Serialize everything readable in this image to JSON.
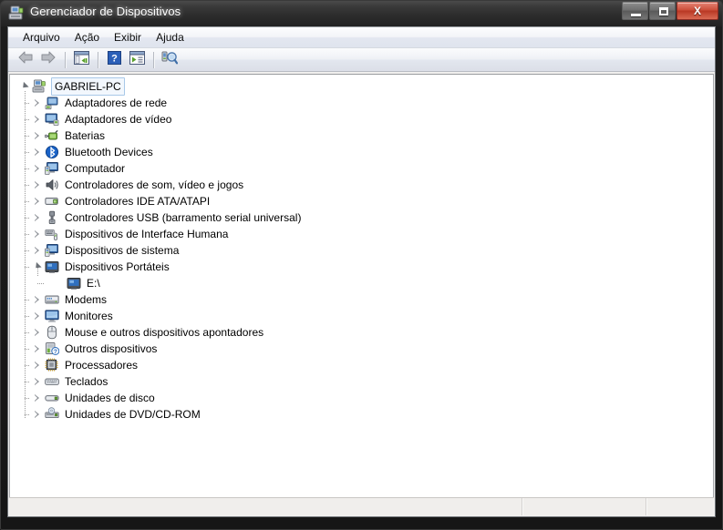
{
  "window": {
    "title": "Gerenciador de Dispositivos",
    "title_icon": "device-manager-icon",
    "buttons": {
      "minimize": "minimize-button",
      "maximize": "maximize-button",
      "close_label": "X"
    }
  },
  "menubar": {
    "items": [
      {
        "label": "Arquivo",
        "name": "menu-arquivo"
      },
      {
        "label": "Ação",
        "name": "menu-acao"
      },
      {
        "label": "Exibir",
        "name": "menu-exibir"
      },
      {
        "label": "Ajuda",
        "name": "menu-ajuda"
      }
    ]
  },
  "toolbar": {
    "items": [
      {
        "name": "back-arrow-icon",
        "type": "button"
      },
      {
        "name": "forward-arrow-icon",
        "type": "button"
      },
      {
        "name": "separator-1",
        "type": "separator"
      },
      {
        "name": "show-hide-console-tree-icon",
        "type": "button"
      },
      {
        "name": "separator-2",
        "type": "separator"
      },
      {
        "name": "help-icon",
        "type": "button"
      },
      {
        "name": "properties-icon",
        "type": "button"
      },
      {
        "name": "separator-3",
        "type": "separator"
      },
      {
        "name": "scan-for-hardware-changes-icon",
        "type": "button"
      }
    ]
  },
  "tree": {
    "root": {
      "label": "GABRIEL-PC",
      "icon": "computer-tower-icon",
      "expanded": true,
      "selected": true
    },
    "nodes": [
      {
        "label": "Adaptadores de rede",
        "icon": "network-adapter-icon",
        "expanded": false
      },
      {
        "label": "Adaptadores de vídeo",
        "icon": "display-adapter-icon",
        "expanded": false
      },
      {
        "label": "Baterias",
        "icon": "battery-icon",
        "expanded": false
      },
      {
        "label": "Bluetooth Devices",
        "icon": "bluetooth-icon",
        "expanded": false
      },
      {
        "label": "Computador",
        "icon": "computer-icon",
        "expanded": false
      },
      {
        "label": "Controladores de som, vídeo e jogos",
        "icon": "sound-speaker-icon",
        "expanded": false
      },
      {
        "label": "Controladores IDE ATA/ATAPI",
        "icon": "ide-controller-icon",
        "expanded": false
      },
      {
        "label": "Controladores USB (barramento serial universal)",
        "icon": "usb-icon",
        "expanded": false
      },
      {
        "label": "Dispositivos de Interface Humana",
        "icon": "hid-device-icon",
        "expanded": false
      },
      {
        "label": "Dispositivos de sistema",
        "icon": "system-device-icon",
        "expanded": false
      },
      {
        "label": "Dispositivos Portáteis",
        "icon": "portable-device-icon",
        "expanded": true,
        "children": [
          {
            "label": "E:\\",
            "icon": "portable-device-icon"
          }
        ]
      },
      {
        "label": "Modems",
        "icon": "modem-icon",
        "expanded": false
      },
      {
        "label": "Monitores",
        "icon": "monitor-icon",
        "expanded": false
      },
      {
        "label": "Mouse e outros dispositivos apontadores",
        "icon": "mouse-icon",
        "expanded": false
      },
      {
        "label": "Outros dispositivos",
        "icon": "unknown-device-icon",
        "expanded": false
      },
      {
        "label": "Processadores",
        "icon": "processor-icon",
        "expanded": false
      },
      {
        "label": "Teclados",
        "icon": "keyboard-icon",
        "expanded": false
      },
      {
        "label": "Unidades de disco",
        "icon": "disk-drive-icon",
        "expanded": false
      },
      {
        "label": "Unidades de DVD/CD-ROM",
        "icon": "dvd-drive-icon",
        "expanded": false
      }
    ]
  },
  "statusbar": {
    "panes": [
      "",
      "",
      ""
    ]
  },
  "colors": {
    "title_bar": "#1d1d1d",
    "close_button": "#cc4e3a",
    "tree_background": "#ffffff",
    "selection_border": "#a8c8e8",
    "menu_bar": "#e3e7f0",
    "status_bar": "#f0eeec"
  }
}
